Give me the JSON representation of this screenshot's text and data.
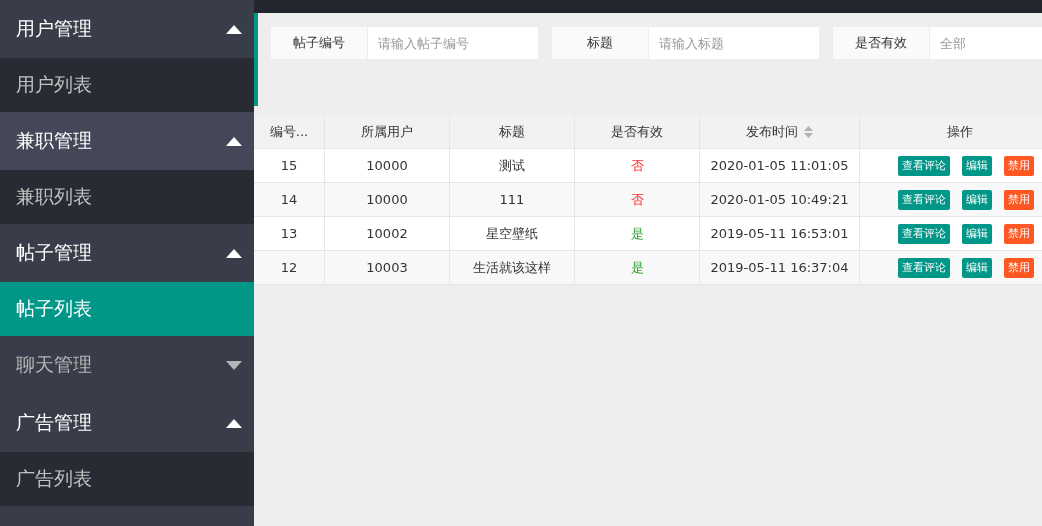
{
  "sidebar": {
    "groups": [
      {
        "label": "用户管理",
        "expanded": true,
        "hover": false,
        "items": [
          {
            "label": "用户列表",
            "selected": false
          }
        ]
      },
      {
        "label": "兼职管理",
        "expanded": true,
        "hover": true,
        "items": [
          {
            "label": "兼职列表",
            "selected": false
          }
        ]
      },
      {
        "label": "帖子管理",
        "expanded": true,
        "hover": false,
        "items": [
          {
            "label": "帖子列表",
            "selected": true
          }
        ]
      },
      {
        "label": "聊天管理",
        "expanded": false,
        "hover": false
      },
      {
        "label": "广告管理",
        "expanded": true,
        "hover": false,
        "items": [
          {
            "label": "广告列表",
            "selected": false
          }
        ]
      }
    ]
  },
  "filters": [
    {
      "label": "帖子编号",
      "placeholder": "请输入帖子编号"
    },
    {
      "label": "标题",
      "placeholder": "请输入标题"
    },
    {
      "label": "是否有效",
      "placeholder": "全部"
    }
  ],
  "table": {
    "columns": [
      {
        "label": "编号...",
        "sortable": false
      },
      {
        "label": "所属用户",
        "sortable": false
      },
      {
        "label": "标题",
        "sortable": false
      },
      {
        "label": "是否有效",
        "sortable": false
      },
      {
        "label": "发布时间",
        "sortable": true
      },
      {
        "label": "操作",
        "sortable": false
      }
    ],
    "rows": [
      {
        "id": "15",
        "user": "10000",
        "title": "测试",
        "valid": false,
        "valid_text": "否",
        "time": "2020-01-05 11:01:05",
        "actions": [
          "查看评论",
          "编辑",
          "禁用"
        ]
      },
      {
        "id": "14",
        "user": "10000",
        "title": "111",
        "valid": false,
        "valid_text": "否",
        "time": "2020-01-05 10:49:21",
        "actions": [
          "查看评论",
          "编辑",
          "禁用"
        ]
      },
      {
        "id": "13",
        "user": "10002",
        "title": "星空壁纸",
        "valid": true,
        "valid_text": "是",
        "time": "2019-05-11 16:53:01",
        "actions": [
          "查看评论",
          "编辑",
          "禁用"
        ]
      },
      {
        "id": "12",
        "user": "10003",
        "title": "生活就该这样",
        "valid": true,
        "valid_text": "是",
        "time": "2019-05-11 16:37:04",
        "actions": [
          "查看评论",
          "编辑",
          "禁用"
        ]
      }
    ]
  }
}
